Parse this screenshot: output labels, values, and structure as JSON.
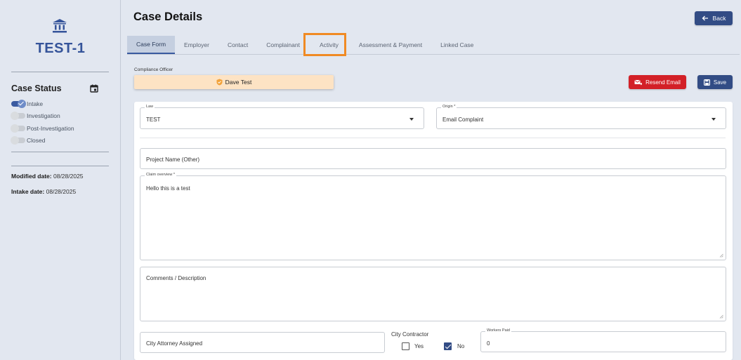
{
  "sidebar": {
    "case_id": "TEST-1",
    "status_title": "Case Status",
    "statuses": [
      {
        "label": "Intake",
        "on": true
      },
      {
        "label": "Investigation",
        "on": false
      },
      {
        "label": "Post-Investigation",
        "on": false
      },
      {
        "label": "Closed",
        "on": false
      }
    ],
    "modified_label": "Modified date:",
    "modified_value": "08/28/2025",
    "intake_label": "Intake date:",
    "intake_value": "08/28/2025"
  },
  "header": {
    "title": "Case Details",
    "back_label": "Back"
  },
  "tabs": [
    {
      "label": "Case Form",
      "active": true
    },
    {
      "label": "Employer",
      "active": false
    },
    {
      "label": "Contact",
      "active": false
    },
    {
      "label": "Complainant",
      "active": false
    },
    {
      "label": "Activity",
      "active": false,
      "highlighted": true
    },
    {
      "label": "Assessment & Payment",
      "active": false
    },
    {
      "label": "Linked Case",
      "active": false
    }
  ],
  "compliance": {
    "label": "Compliance Officer",
    "officer": "Dave Test"
  },
  "actions": {
    "resend_label": "Resend Email",
    "save_label": "Save"
  },
  "form": {
    "law_label": "Law",
    "law_value": "TEST",
    "origin_label": "Origin *",
    "origin_value": "Email Complaint",
    "project_name_placeholder": "Project Name (Other)",
    "claim_label": "Claim overview *",
    "claim_value": "Hello this is a test",
    "comments_placeholder": "Comments / Description",
    "attorney_placeholder": "City Attorney Assigned",
    "contractor_label": "City Contractor",
    "contractor_yes": "Yes",
    "contractor_no": "No",
    "contractor_value": "No",
    "workers_paid_label": "Workers Paid",
    "workers_paid_value": "0"
  },
  "colors": {
    "accent": "#324c85",
    "danger": "#d32027",
    "highlight": "#f08a24",
    "officer_bg": "#fde3c4"
  }
}
